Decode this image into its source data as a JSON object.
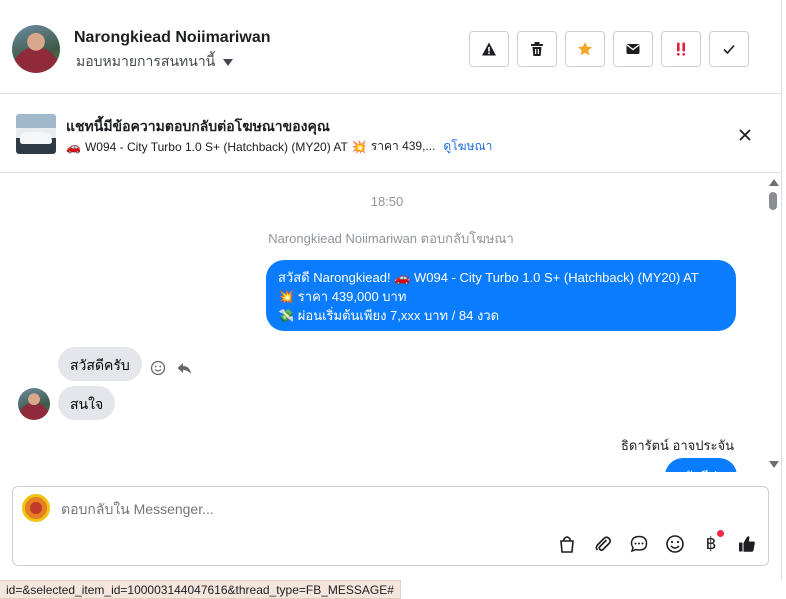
{
  "header": {
    "contact_name": "Narongkiead Noiimariwan",
    "assign_label": "มอบหมายการสนทนานี้",
    "actions": [
      {
        "name": "report-button",
        "icon": "warning-icon"
      },
      {
        "name": "delete-button",
        "icon": "trash-icon"
      },
      {
        "name": "star-button",
        "icon": "star-icon",
        "color": "#f5a623"
      },
      {
        "name": "mark-unread-button",
        "icon": "envelope-icon"
      },
      {
        "name": "spam-button",
        "icon": "exclamation-icon",
        "color": "#e41e3f"
      },
      {
        "name": "done-button",
        "icon": "check-icon"
      }
    ]
  },
  "ad_banner": {
    "title": "แชทนี้มีข้อความตอบกลับต่อโฆษณาของคุณ",
    "desc": "W094 - City Turbo 1.0 S+ (Hatchback) (MY20) AT",
    "price_snippet": "ราคา 439,...",
    "link": "ดูโฆษณา"
  },
  "messages": {
    "timestamp": "18:50",
    "system_note": "Narongkiead Noiimariwan ตอบกลับโฆษณา",
    "outgoing": {
      "line1": "สวัสดี Narongkiead! 🚗 W094 - City Turbo 1.0 S+ (Hatchback) (MY20) AT",
      "line2": "💥 ราคา 439,000 บาท",
      "line3": "💸 ผ่อนเริ่มต้นเพียง 7,xxx บาท / 84 งวด"
    },
    "incoming_1": "สวัสดีครับ",
    "incoming_2": "สนใจ",
    "sender_2": "ธิดารัตน์ อาจประจัน",
    "partial_outgoing": "สวัสดีค่ะ"
  },
  "composer": {
    "placeholder": "ตอบกลับใน Messenger...",
    "baht_symbol": "฿"
  },
  "status_url": "id=&selected_item_id=100003144047616&thread_type=FB_MESSAGE#",
  "colors": {
    "accent": "#0a7cff",
    "link": "#216fdb",
    "star": "#f5a623",
    "spam": "#e41e3f"
  }
}
